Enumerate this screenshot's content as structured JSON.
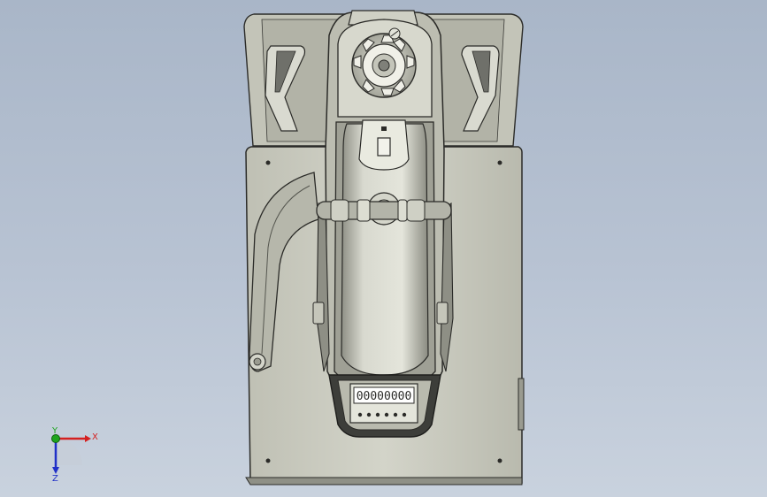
{
  "viewport": {
    "background_top": "#a9b6c8",
    "background_bottom": "#c9d2de"
  },
  "model": {
    "body_color": "#c8c9bd",
    "shade_color": "#a9aa9e",
    "edge_color": "#2b2b28",
    "counter_digits": "00000000"
  },
  "triad": {
    "x_label": "X",
    "y_label": "Y",
    "z_label": "Z",
    "x_color": "#d42020",
    "y_color": "#1ea51e",
    "z_color": "#2030c8"
  }
}
